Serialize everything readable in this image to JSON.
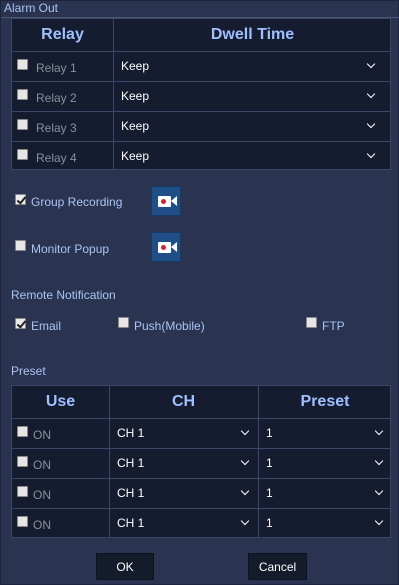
{
  "window": {
    "title": "Alarm Out"
  },
  "relay_table": {
    "headers": {
      "relay": "Relay",
      "dwell": "Dwell Time"
    },
    "rows": [
      {
        "label": "Relay 1",
        "dwell": "Keep",
        "checked": false
      },
      {
        "label": "Relay 2",
        "dwell": "Keep",
        "checked": false
      },
      {
        "label": "Relay 3",
        "dwell": "Keep",
        "checked": false
      },
      {
        "label": "Relay 4",
        "dwell": "Keep",
        "checked": false
      }
    ]
  },
  "group_recording": {
    "label": "Group Recording",
    "checked": true,
    "icon": "camera-icon"
  },
  "monitor_popup": {
    "label": "Monitor Popup",
    "checked": false,
    "icon": "camera-icon"
  },
  "remote_notification": {
    "title": "Remote Notification",
    "email": {
      "label": "Email",
      "checked": true
    },
    "push": {
      "label": "Push(Mobile)",
      "checked": false
    },
    "ftp": {
      "label": "FTP",
      "checked": false
    }
  },
  "preset_section": {
    "title": "Preset",
    "headers": {
      "use": "Use",
      "ch": "CH",
      "preset": "Preset"
    },
    "rows": [
      {
        "use": "ON",
        "ch": "CH 1",
        "preset": "1",
        "checked": false
      },
      {
        "use": "ON",
        "ch": "CH 1",
        "preset": "1",
        "checked": false
      },
      {
        "use": "ON",
        "ch": "CH 1",
        "preset": "1",
        "checked": false
      },
      {
        "use": "ON",
        "ch": "CH 1",
        "preset": "1",
        "checked": false
      }
    ]
  },
  "buttons": {
    "ok": "OK",
    "cancel": "Cancel"
  },
  "colors": {
    "accent": "#9fbfff",
    "label": "#a9c4f2",
    "dialog_bg": "#2a3451",
    "table_bg": "#151c30",
    "icon_bg": "#1f4f86",
    "record_dot": "#d0262d"
  }
}
